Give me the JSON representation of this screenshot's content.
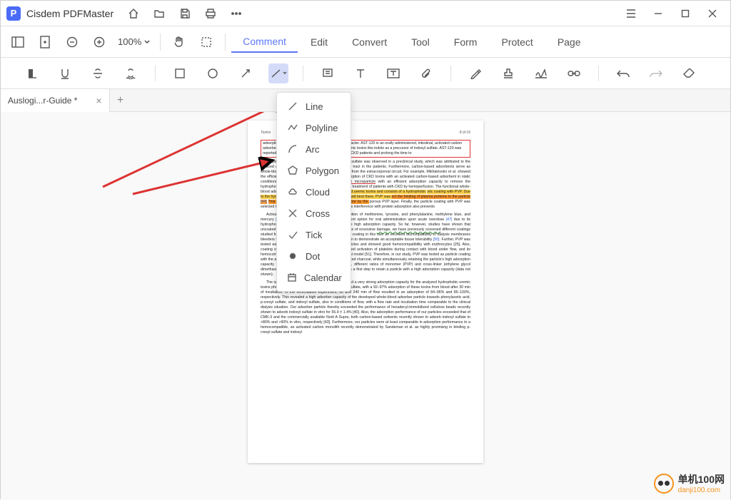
{
  "app": {
    "name": "Cisdem PDFMaster"
  },
  "titlebar_icons": [
    "home",
    "open",
    "save",
    "print",
    "more"
  ],
  "zoom": "100%",
  "main_menu": {
    "comment": "Comment",
    "edit": "Edit",
    "convert": "Convert",
    "tool": "Tool",
    "form": "Form",
    "protect": "Protect",
    "page": "Page"
  },
  "doc_tab": {
    "label": "Auslogi...r-Guide *"
  },
  "dropdown": [
    {
      "icon": "line",
      "label": "Line"
    },
    {
      "icon": "polyline",
      "label": "Polyline"
    },
    {
      "icon": "arc",
      "label": "Arc"
    },
    {
      "icon": "polygon",
      "label": "Polygon"
    },
    {
      "icon": "cloud",
      "label": "Cloud"
    },
    {
      "icon": "cross",
      "label": "Cross"
    },
    {
      "icon": "tick",
      "label": "Tick"
    },
    {
      "icon": "dot",
      "label": "Dot"
    },
    {
      "icon": "calendar",
      "label": "Calendar"
    }
  ],
  "page_meta": {
    "journal": "Toxins",
    "pagenum": "8 of 16"
  },
  "red_box_text": "adsorption capacity for toxins with a hydrophobic character. AST-120 is an orally administered, intestinal, activated carbon adsorbent that binds to gut-derived low-molecular uremic toxins like indole as a precursor of indoxyl sulfate. AST-120 was reported to ameliorate the cardiovascular condition in CKD patients and prolong the time to",
  "para1a": "dialysis; furthermore, a decrease in serum indoxyl sulfate was observed in a preclinical study, which was attributed to the reduced absorption of indole from the gastrointestinal tract in the patients. Furthermore, carbon-based adsorbents serve as whole-blood adsorbers for the chronic therapy of CKD from the extracorporeal circuit. For example, Mikhalovsko et al. showed the efficient removal of uremic toxins studied the adsorption of CKD toxins with an activated carbon-based adsorbent in static conditions",
  "ref43": " [43]. ",
  "para1b": "In this study ",
  "blood_hemo": "blood-hemocompatible microparticle",
  "para1c": " with an efficient adsorption capacity to remove the hydrophobic uremic toxins under flow conditions for the treatment of patients with CKD by hemoperfusion. The functional whole-blood adsorber particle is specifically designed ",
  "hl1": "in-bound uremic toxins and consists of a hydrophobic",
  "hl2": "olic coating with PVP. Due to the hydrophobic, porous",
  "hl3": " into the activated charcoal and bind there.  PVP was ",
  "hl4": "ect the binding of plasma proteins to the particle ",
  "ref44": "[44]",
  "hl5": "This ",
  "hl6": "s of plasma proteins from the hydrophobic core by the ",
  "para_post": "porous PVP layer. Finally, the particle coating with PVP was selected to induce hemocompatibility of the adsorber, as interference with protein adsorption also prevents",
  "para2a": "    Activated charcoal has been used for the adsorption of methionine, tyrosine, and phenylalanine, methylene blue, and mercury ",
  "ref2446": "[24,46]",
  "para2b": ". Also, it is a well-established treatment option for oral administration upon acute overdose ",
  "ref47": "[47]",
  "para2c": " due to its hydrophobicity and large surface area, leading to the high adsorption capacity. So far, however, studies have shown that uncoated activated charcoal was unacceptable because of excessive ",
  "green_text": "damage, we have previously screened",
  "para2d": " different coatings studied found that screening, we selected PVP for the coating in this own an excellent biocompatibility of dialysis membranes bleeders when combined with iodine was already shown to demonstrate an acceptable tissue tolerability ",
  "ref50": "[50]",
  "para3": ". Further, PVP was tested earlier as a surface coating for silver nanoparticles and showed good hemocompatibility with erythrocytes [25]. Also, coating of hydrogel with PVP resulted in the decreased activation of platelets during contact with blood under flow, and its hemocompatibility was also confirmed in a small animal model [51]. Therefore, in our study, PVP was tested as particle coating with the aim to improve the hemocompatibility of activated charcoal, while simultaneously retaining the particle's high adsorption capacity towards hydrophobic compounds. Therefore, different ratios of monomer (PVP) and cross-linker (ethylene glycol dimethacrylate) were tested for the charcoal coating as a first step to retain a particle with a high adsorption capacity (data not shown).",
  "para4": "    The optimized whole-blood adsorber particle showed a very strong adsorption capacity for the analyzed hydrophobic uremic toxins phenylacetic acid, p-cresyl sulfate, and indoxyl sulfate, with a 92–97% adsorption of these toxins from blood after 30 min of incubation. In the recirculation experiment, 60 and 240 min of flow resulted in an adsorption of 84–96% and 95–100%, respectively. This revealed a high adsorber capacity of the developed whole-blood adsorber particle towards phenylacetic acid, p-cresyl sulfate, and indoxyl sulfate, also in conditions of flow, with a flow rate and incubation time comparable to the clinical dialysis situation. Our adsorber particle thereby exceeded the performance of hexadecyl-immobilized cellulose beads recently shown to adsorb indoxyl sulfate in vitro for 55.9 ± 1.4% [40]. Also, the adsorption performance of our particles exceeded that of CMK-3 and the commercially available Norit A Supra, both carbon-based sorbents recently shown to adsorb indoxyl sulfate to >80% and >90% in vitro, respectively [43]. Furthermore, our particles were at least comparable in adsorption performance to a hemocompatible, an activated carbon monolith recently demonstrated by Sandeman et al. as highly promising in binding p-cresyl sulfate and indoxyl",
  "watermark": {
    "line1": "单机100网",
    "line2": "danji100.com"
  }
}
